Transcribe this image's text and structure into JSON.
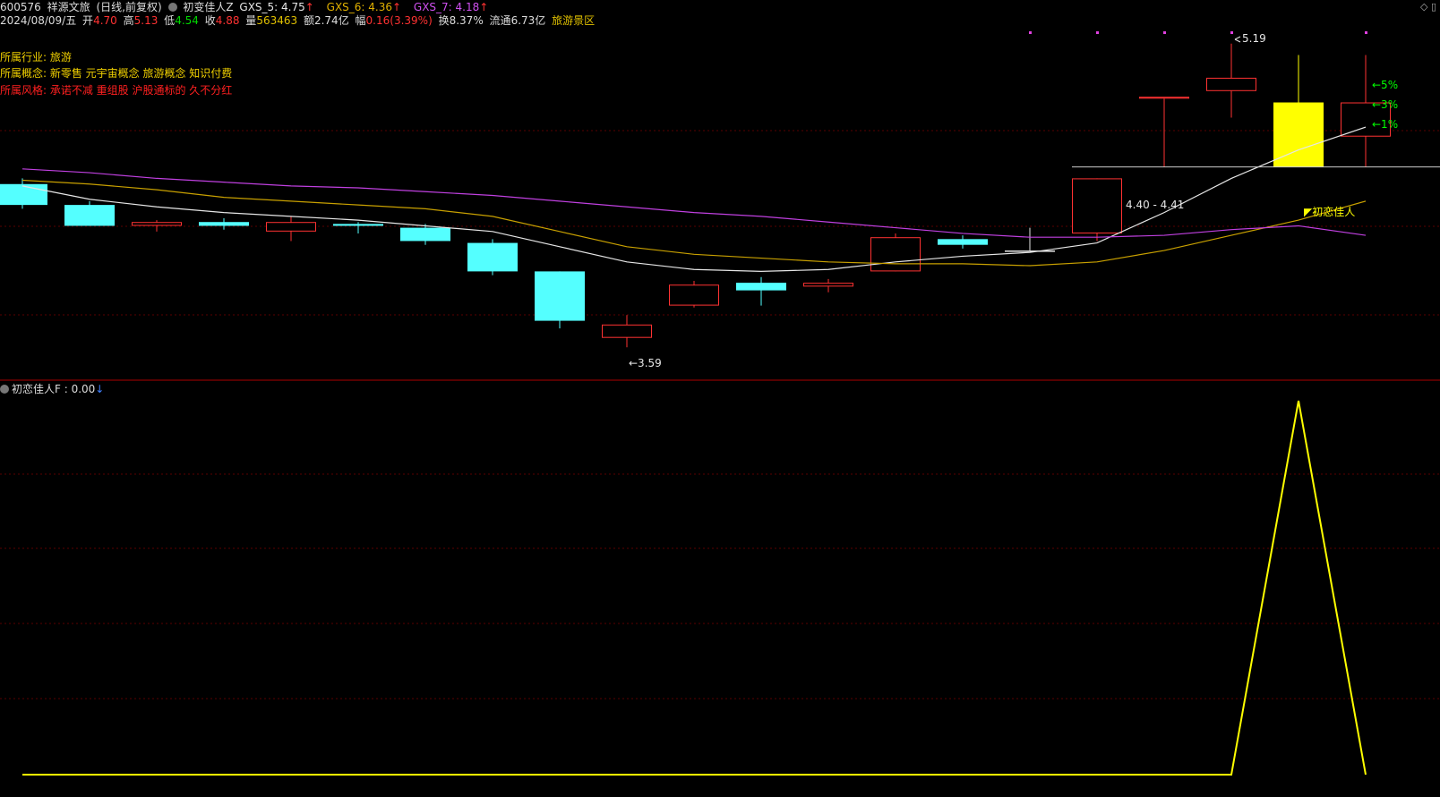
{
  "header": {
    "code": "600576",
    "name": "祥源文旅",
    "mode": "(日线,前复权)",
    "indicator_name": "初变佳人Z",
    "gxs5_label": "GXS_5: 4.75",
    "gxs6_label": "GXS_6: 4.36",
    "gxs7_label": "GXS_7: 4.18",
    "arrow": "↑",
    "date": "2024/08/09/五",
    "open_label": "开",
    "open_value": "4.70",
    "high_label": "高",
    "high_value": "5.13",
    "low_label": "低",
    "low_value": "4.54",
    "close_label": "收",
    "close_value": "4.88",
    "vol_label": "量",
    "vol_value": "563463",
    "amt_label": "额",
    "amt_value": "2.74亿",
    "chg_label": "幅",
    "chg_value": "0.16(3.39%)",
    "turn_label": "换",
    "turn_value": "8.37%",
    "float_label": "流通",
    "float_value": "6.73亿",
    "sector": "旅游景区"
  },
  "info": {
    "industry": "所属行业: 旅游",
    "concept": "所属概念: 新零售 元宇宙概念 旅游概念 知识付费",
    "style": "所属风格: 承诺不减 重组股 沪股通标的 久不分红"
  },
  "sub_panel": {
    "title": "初恋佳人F : 0.00",
    "arrow": "↓"
  },
  "colors": {
    "up": "#ff3232",
    "down": "#54ffff",
    "ma5": "#e6e6e6",
    "ma6": "#c8a000",
    "ma7": "#c040e0",
    "signal": "#ffff00",
    "grid": "#5a0000",
    "pct": "#00ff00"
  },
  "chart_data": {
    "type": "candlestick",
    "price_range": [
      3.45,
      5.25
    ],
    "candles": [
      {
        "o": 4.45,
        "h": 4.48,
        "l": 4.32,
        "c": 4.34,
        "kind": "down"
      },
      {
        "o": 4.34,
        "h": 4.36,
        "l": 4.23,
        "c": 4.23,
        "kind": "down"
      },
      {
        "o": 4.23,
        "h": 4.26,
        "l": 4.2,
        "c": 4.25,
        "kind": "up"
      },
      {
        "o": 4.25,
        "h": 4.27,
        "l": 4.21,
        "c": 4.23,
        "kind": "down"
      },
      {
        "o": 4.2,
        "h": 4.28,
        "l": 4.15,
        "c": 4.25,
        "kind": "up"
      },
      {
        "o": 4.24,
        "h": 4.25,
        "l": 4.19,
        "c": 4.23,
        "kind": "down"
      },
      {
        "o": 4.22,
        "h": 4.24,
        "l": 4.13,
        "c": 4.15,
        "kind": "down"
      },
      {
        "o": 4.14,
        "h": 4.16,
        "l": 3.97,
        "c": 3.99,
        "kind": "down"
      },
      {
        "o": 3.99,
        "h": 3.99,
        "l": 3.69,
        "c": 3.73,
        "kind": "down"
      },
      {
        "o": 3.71,
        "h": 3.76,
        "l": 3.59,
        "c": 3.64,
        "kind": "up"
      },
      {
        "o": 3.81,
        "h": 3.94,
        "l": 3.8,
        "c": 3.92,
        "kind": "up"
      },
      {
        "o": 3.93,
        "h": 3.96,
        "l": 3.81,
        "c": 3.89,
        "kind": "down"
      },
      {
        "o": 3.91,
        "h": 3.95,
        "l": 3.88,
        "c": 3.93,
        "kind": "up"
      },
      {
        "o": 3.99,
        "h": 4.19,
        "l": 3.99,
        "c": 4.17,
        "kind": "up"
      },
      {
        "o": 4.16,
        "h": 4.18,
        "l": 4.11,
        "c": 4.13,
        "kind": "down"
      },
      {
        "o": 4.1,
        "h": 4.22,
        "l": 4.1,
        "c": 4.1,
        "kind": "flat"
      },
      {
        "o": 4.19,
        "h": 4.48,
        "l": 4.15,
        "c": 4.48,
        "kind": "up"
      },
      {
        "o": 4.9,
        "h": 4.9,
        "l": 4.54,
        "c": 4.91,
        "kind": "up"
      },
      {
        "o": 4.94,
        "h": 5.19,
        "l": 4.8,
        "c": 5.01,
        "kind": "up"
      },
      {
        "o": 4.54,
        "h": 5.13,
        "l": 4.54,
        "c": 4.88,
        "kind": "yellow"
      },
      {
        "o": 4.7,
        "h": 5.13,
        "l": 4.54,
        "c": 4.88,
        "kind": "up"
      }
    ],
    "series": [
      {
        "name": "GXS_5",
        "values": [
          4.44,
          4.37,
          4.33,
          4.3,
          4.28,
          4.26,
          4.23,
          4.2,
          4.12,
          4.04,
          4.0,
          3.99,
          4.0,
          4.04,
          4.07,
          4.09,
          4.14,
          4.3,
          4.48,
          4.63,
          4.75
        ]
      },
      {
        "name": "GXS_6",
        "values": [
          4.47,
          4.45,
          4.42,
          4.38,
          4.36,
          4.34,
          4.32,
          4.28,
          4.2,
          4.12,
          4.08,
          4.06,
          4.04,
          4.03,
          4.03,
          4.02,
          4.04,
          4.1,
          4.18,
          4.26,
          4.36
        ]
      },
      {
        "name": "GXS_7",
        "values": [
          4.53,
          4.51,
          4.48,
          4.46,
          4.44,
          4.43,
          4.41,
          4.39,
          4.36,
          4.33,
          4.3,
          4.28,
          4.25,
          4.22,
          4.19,
          4.17,
          4.17,
          4.18,
          4.21,
          4.23,
          4.18
        ]
      }
    ],
    "annotations": {
      "high": "5.19",
      "low": "←3.59",
      "range": "4.40 - 4.41",
      "signal": "初恋佳人",
      "pct": [
        "←5%",
        "←3%",
        "←1%"
      ]
    },
    "sub_values": [
      0,
      0,
      0,
      0,
      0,
      0,
      0,
      0,
      0,
      0,
      0,
      0,
      0,
      0,
      0,
      0,
      0,
      0,
      0,
      1,
      0
    ],
    "sub_range": [
      0,
      1
    ]
  }
}
